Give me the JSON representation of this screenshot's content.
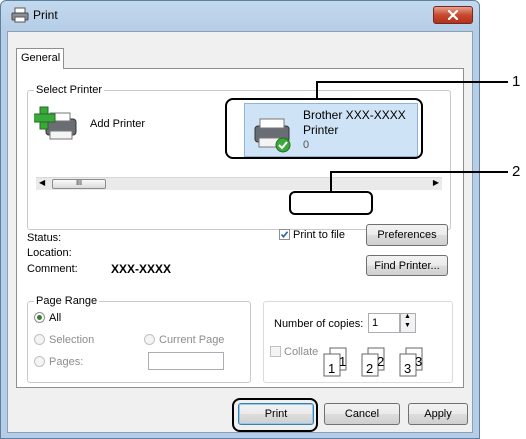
{
  "window": {
    "title": "Print",
    "close_icon": "close-x-icon"
  },
  "tabs": [
    {
      "label": "General"
    }
  ],
  "select_printer": {
    "label": "Select Printer",
    "add_printer_label": "Add Printer",
    "printer_name_line1": "Brother XXX-XXXX",
    "printer_name_line2": "Printer",
    "printer_jobs": "0",
    "scrollbar_thumb": "III"
  },
  "details": {
    "status_label": "Status:",
    "location_label": "Location:",
    "comment_label": "Comment:",
    "comment_value": "XXX-XXXX",
    "print_to_file_label": "Print to file",
    "print_to_file_checked": true,
    "preferences_label": "Preferences",
    "find_printer_label": "Find Printer..."
  },
  "page_range": {
    "label": "Page Range",
    "all_label": "All",
    "selection_label": "Selection",
    "current_page_label": "Current Page",
    "pages_label": "Pages:",
    "pages_value": ""
  },
  "copies": {
    "number_label": "Number of copies:",
    "number_value": "1",
    "collate_label": "Collate"
  },
  "footer": {
    "print_label": "Print",
    "cancel_label": "Cancel",
    "apply_label": "Apply"
  },
  "callouts": [
    {
      "number": "1"
    },
    {
      "number": "2"
    }
  ]
}
